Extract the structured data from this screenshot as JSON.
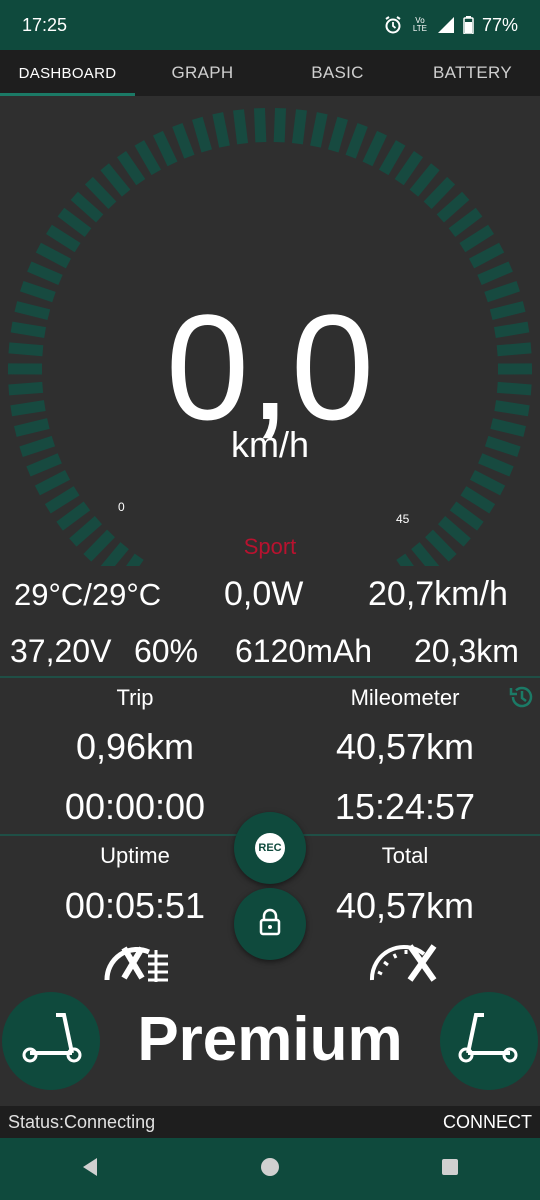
{
  "status_bar": {
    "time": "17:25",
    "battery": "77%",
    "network": "Vo LTE"
  },
  "tabs": [
    {
      "label": "DASHBOARD",
      "active": true
    },
    {
      "label": "GRAPH",
      "active": false
    },
    {
      "label": "BASIC",
      "active": false
    },
    {
      "label": "BATTERY",
      "active": false
    }
  ],
  "gauge": {
    "speed": "0,0",
    "unit": "km/h",
    "min_label": "0",
    "max_label": "45",
    "mode": "Sport",
    "level": 0
  },
  "stats_row1": {
    "temps": "29°C/29°C",
    "power": "0,0W",
    "avg_speed": "20,7km/h"
  },
  "stats_row2": {
    "voltage": "37,20V",
    "battery_pct": "60%",
    "capacity": "6120mAh",
    "range": "20,3km"
  },
  "trip": {
    "label": "Trip",
    "distance": "0,96km",
    "time": "00:00:00"
  },
  "mileometer": {
    "label": "Mileometer",
    "distance": "40,57km",
    "time": "15:24:57"
  },
  "uptime": {
    "label": "Uptime",
    "value": "00:05:51"
  },
  "total": {
    "label": "Total",
    "value": "40,57km"
  },
  "rec_label": "REC",
  "premium_label": "Premium",
  "status_line": {
    "status": "Status:Connecting",
    "connect_label": "CONNECT"
  },
  "colors": {
    "accent": "#0f4a3d",
    "tab_indicator": "#1b7a66",
    "mode": "#b8122f",
    "background": "#2f2f2f"
  }
}
